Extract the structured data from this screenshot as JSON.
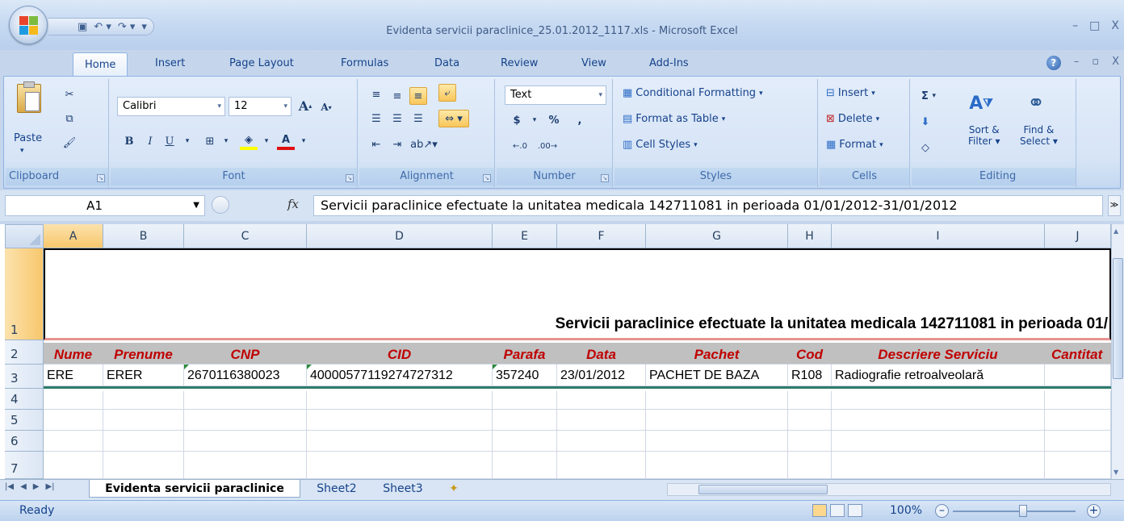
{
  "window": {
    "title": "Evidenta servicii paraclinice_25.01.2012_1117.xls - Microsoft Excel",
    "controls": [
      "–",
      "□",
      "X"
    ]
  },
  "ribbon_tabs": [
    "Home",
    "Insert",
    "Page Layout",
    "Formulas",
    "Data",
    "Review",
    "View",
    "Add-Ins"
  ],
  "active_tab": "Home",
  "ribbon": {
    "clipboard": {
      "label": "Clipboard",
      "paste": "Paste"
    },
    "font": {
      "label": "Font",
      "name": "Calibri",
      "size": "12",
      "bold": "B",
      "italic": "I",
      "underline": "U"
    },
    "alignment": {
      "label": "Alignment"
    },
    "number": {
      "label": "Number",
      "format": "Text",
      "currency": "$",
      "percent": "%",
      "comma": ","
    },
    "styles": {
      "label": "Styles",
      "conditional": "Conditional Formatting",
      "format_table": "Format as Table",
      "cell_styles": "Cell Styles"
    },
    "cells": {
      "label": "Cells",
      "insert": "Insert",
      "delete": "Delete",
      "format": "Format"
    },
    "editing": {
      "label": "Editing",
      "sum": "Σ",
      "sort": "Sort &",
      "sort2": "Filter",
      "find": "Find &",
      "find2": "Select"
    }
  },
  "formula_bar": {
    "name_box": "A1",
    "fx": "fx",
    "formula": "Servicii paraclinice efectuate la unitatea medicala 142711081 in perioada 01/01/2012-31/01/2012"
  },
  "columns": [
    "A",
    "B",
    "C",
    "D",
    "E",
    "F",
    "G",
    "H",
    "I",
    "J"
  ],
  "row_numbers": [
    "1",
    "2",
    "3",
    "4",
    "5",
    "6",
    "7"
  ],
  "sheet": {
    "title_text": "Servicii paraclinice efectuate la unitatea medicala 142711081 in perioada 01/",
    "headers": [
      "Nume",
      "Prenume",
      "CNP",
      "CID",
      "Parafa",
      "Data",
      "Pachet",
      "Cod",
      "Descriere Serviciu",
      "Cantitat"
    ],
    "row3": [
      "ERE",
      "ERER",
      "2670116380023",
      "40000577119274727312",
      "357240",
      "23/01/2012",
      "PACHET DE BAZA",
      "R108",
      "Radiografie retroalveolară",
      ""
    ]
  },
  "sheet_tabs": [
    "Evidenta servicii paraclinice",
    "Sheet2",
    "Sheet3"
  ],
  "status": {
    "text": "Ready",
    "zoom": "100%"
  },
  "colors": {
    "header_fill": "#c0c0c0",
    "header_text": "#c00000",
    "selection": "#f8c76c"
  }
}
